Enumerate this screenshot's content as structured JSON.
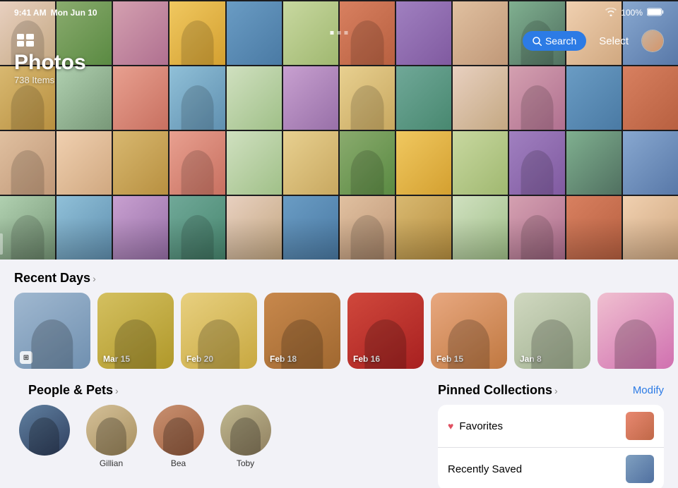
{
  "statusBar": {
    "time": "9:41 AM",
    "day": "Mon Jun 10",
    "wifi": "wifi",
    "battery": "100%"
  },
  "header": {
    "title": "Photos",
    "itemCount": "738 Items",
    "searchLabel": "Search",
    "selectLabel": "Select"
  },
  "recentDays": {
    "sectionTitle": "Recent Days",
    "chevron": "›",
    "cards": [
      {
        "label": "",
        "hasIcon": true,
        "colorClass": "dc1"
      },
      {
        "label": "Mar 15",
        "hasIcon": false,
        "colorClass": "dc2"
      },
      {
        "label": "Feb 20",
        "hasIcon": false,
        "colorClass": "dc3"
      },
      {
        "label": "Feb 18",
        "hasIcon": false,
        "colorClass": "dc4"
      },
      {
        "label": "Feb 16",
        "hasIcon": false,
        "colorClass": "dc5"
      },
      {
        "label": "Feb 15",
        "hasIcon": false,
        "colorClass": "dc6"
      },
      {
        "label": "Jan 8",
        "hasIcon": false,
        "colorClass": "dc7"
      },
      {
        "label": "",
        "hasIcon": false,
        "colorClass": "dc8"
      }
    ]
  },
  "people": {
    "sectionTitle": "People & Pets",
    "chevron": "›",
    "items": [
      {
        "name": "",
        "colorClass": "pc1",
        "hasHeart": false
      },
      {
        "name": "Gillian",
        "colorClass": "pc2",
        "hasHeart": false
      },
      {
        "name": "Bea",
        "colorClass": "pc3",
        "hasHeart": false
      },
      {
        "name": "Toby",
        "colorClass": "pc4",
        "hasHeart": false
      }
    ]
  },
  "pinnedCollections": {
    "sectionTitle": "Pinned Collections",
    "chevron": "›",
    "modifyLabel": "Modify",
    "items": [
      {
        "name": "Favorites",
        "icon": "heart",
        "thumbClass": "pt1"
      },
      {
        "name": "Recently Saved",
        "icon": "none",
        "thumbClass": "pt2"
      }
    ]
  },
  "grid": {
    "rows": 4,
    "cols": 12,
    "colorClasses": [
      "c1",
      "c2",
      "c3",
      "c4",
      "c5",
      "c6",
      "c7",
      "c8",
      "c9",
      "c10",
      "c11",
      "c12",
      "c13",
      "c14",
      "c15",
      "c16",
      "c17",
      "c18",
      "c19",
      "c20",
      "c1",
      "c3",
      "c5",
      "c7",
      "c9",
      "c11",
      "c13",
      "c15",
      "c17",
      "c19",
      "c2",
      "c4",
      "c6",
      "c8",
      "c10",
      "c12",
      "c14",
      "c16",
      "c18",
      "c20",
      "c1",
      "c5",
      "c9",
      "c13",
      "c17",
      "c3",
      "c7",
      "c11"
    ]
  }
}
